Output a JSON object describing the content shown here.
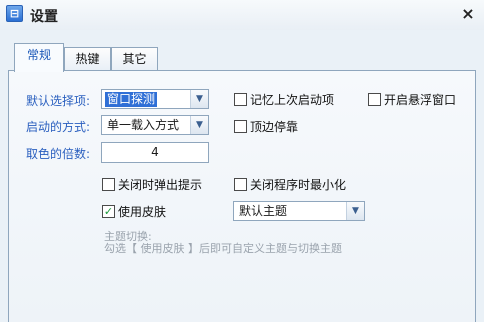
{
  "window": {
    "icon": "settings-app-icon",
    "icon_glyph": "⊟",
    "title": "设置",
    "close_glyph": "×"
  },
  "tabs": [
    {
      "label": "常规",
      "active": true
    },
    {
      "label": "热键",
      "active": false
    },
    {
      "label": "其它",
      "active": false
    }
  ],
  "general": {
    "default_option": {
      "label": "默认选择项:",
      "value": "窗口探测"
    },
    "startup_mode": {
      "label": "启动的方式:",
      "value": "单一载入方式"
    },
    "color_multiplier": {
      "label": "取色的倍数:",
      "value": "4"
    },
    "remember_last_launch": {
      "label": "记忆上次启动项",
      "checked": false
    },
    "floating_window": {
      "label": "开启悬浮窗口",
      "checked": false
    },
    "dock_top": {
      "label": "顶边停靠",
      "checked": false
    },
    "popup_on_close": {
      "label": "关闭时弹出提示",
      "checked": false
    },
    "minimize_on_close": {
      "label": "关闭程序时最小化",
      "checked": false
    },
    "use_skin": {
      "label": "使用皮肤",
      "checked": true,
      "check_glyph": "✓"
    },
    "theme": {
      "value": "默认主题"
    },
    "hint_title": "主题切换:",
    "hint_text": "勾选【 使用皮肤 】后即可自定义主题与切换主题",
    "dropdown_glyph": "▼"
  },
  "colors": {
    "label_blue": "#2a5fbf",
    "selection_blue": "#2f6fd6",
    "panel_border": "#8fa6bd",
    "check_green": "#1a9a3a",
    "hint_gray": "#9aa3ad"
  }
}
